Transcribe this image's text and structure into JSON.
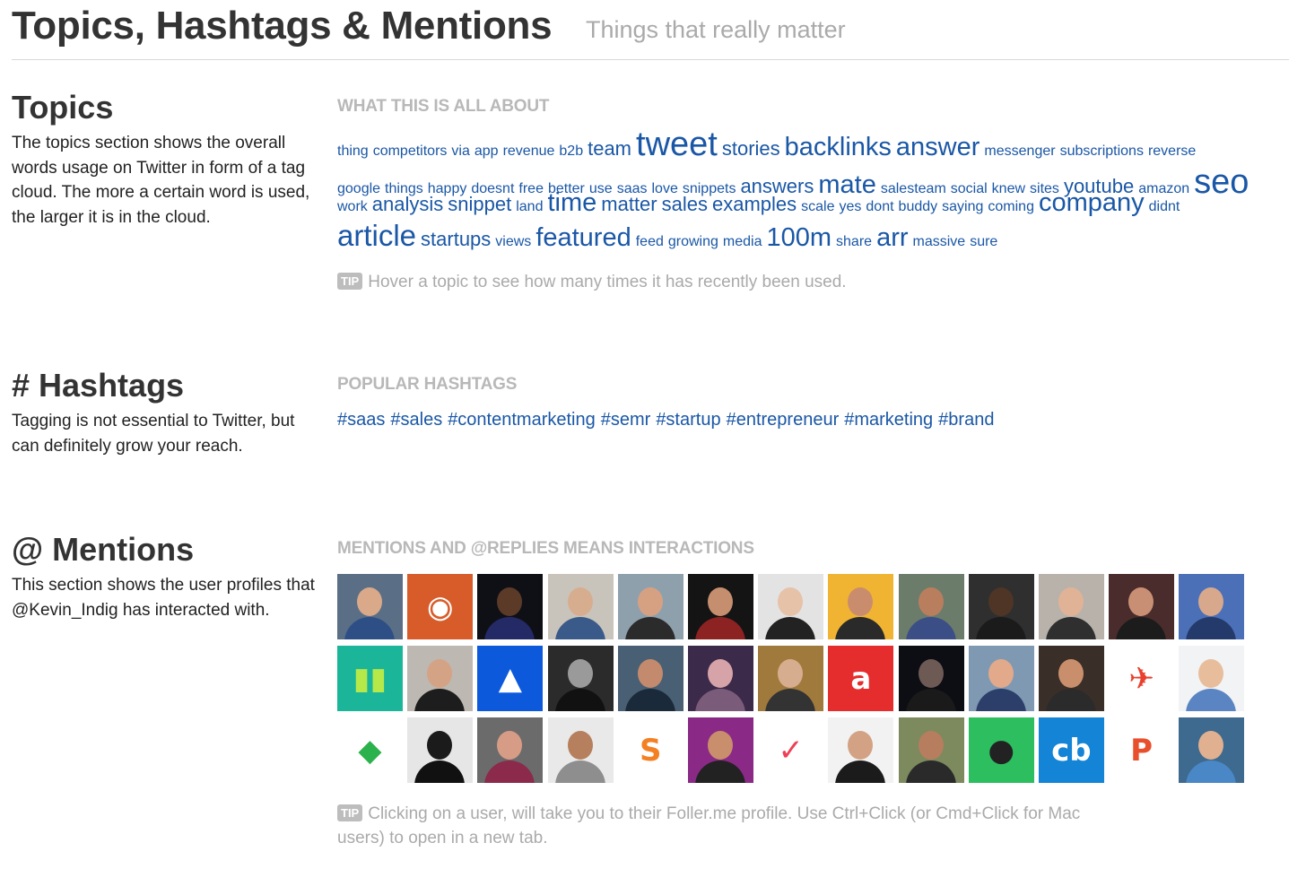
{
  "header": {
    "title": "Topics, Hashtags & Mentions",
    "subtitle": "Things that really matter"
  },
  "topics": {
    "title": "Topics",
    "description": "The topics section shows the overall words usage on Twitter in form of a tag cloud. The more a certain word is used, the larger it is in the cloud.",
    "kicker": "WHAT THIS IS ALL ABOUT",
    "tip_badge": "TIP",
    "tip": "Hover a topic to see how many times it has recently been used.",
    "cloud": [
      [
        {
          "word": "thing",
          "size": 1
        },
        {
          "word": "competitors",
          "size": 1
        },
        {
          "word": "via",
          "size": 1
        },
        {
          "word": "app",
          "size": 1
        },
        {
          "word": "revenue",
          "size": 1
        },
        {
          "word": "b2b",
          "size": 1
        },
        {
          "word": "team",
          "size": 3
        },
        {
          "word": "tweet",
          "size": 7
        },
        {
          "word": "stories",
          "size": 3
        },
        {
          "word": "backlinks",
          "size": 5
        },
        {
          "word": "answer",
          "size": 5
        },
        {
          "word": "messenger",
          "size": 1
        },
        {
          "word": "subscriptions",
          "size": 1
        },
        {
          "word": "reverse",
          "size": 1
        }
      ],
      [
        {
          "word": "google",
          "size": 1
        },
        {
          "word": "things",
          "size": 1
        },
        {
          "word": "happy",
          "size": 1
        },
        {
          "word": "doesnt",
          "size": 1
        },
        {
          "word": "free",
          "size": 1
        },
        {
          "word": "better",
          "size": 1
        },
        {
          "word": "use",
          "size": 1
        },
        {
          "word": "saas",
          "size": 1
        },
        {
          "word": "love",
          "size": 1
        },
        {
          "word": "snippets",
          "size": 1
        },
        {
          "word": "answers",
          "size": 3
        },
        {
          "word": "mate",
          "size": 5
        },
        {
          "word": "salesteam",
          "size": 1
        },
        {
          "word": "social",
          "size": 1
        },
        {
          "word": "knew",
          "size": 1
        },
        {
          "word": "sites",
          "size": 1
        },
        {
          "word": "youtube",
          "size": 3
        },
        {
          "word": "amazon",
          "size": 1
        },
        {
          "word": "seo",
          "size": 7
        }
      ],
      [
        {
          "word": "work",
          "size": 1
        },
        {
          "word": "analysis",
          "size": 3
        },
        {
          "word": "snippet",
          "size": 3
        },
        {
          "word": "land",
          "size": 1
        },
        {
          "word": "time",
          "size": 5
        },
        {
          "word": "matter",
          "size": 3
        },
        {
          "word": "sales",
          "size": 3
        },
        {
          "word": "examples",
          "size": 3
        },
        {
          "word": "scale",
          "size": 1
        },
        {
          "word": "yes",
          "size": 1
        },
        {
          "word": "dont",
          "size": 1
        },
        {
          "word": "buddy",
          "size": 1
        },
        {
          "word": "saying",
          "size": 1
        },
        {
          "word": "coming",
          "size": 1
        },
        {
          "word": "company",
          "size": 5
        },
        {
          "word": "didnt",
          "size": 1
        }
      ],
      [
        {
          "word": "article",
          "size": 6
        },
        {
          "word": "startups",
          "size": 3
        },
        {
          "word": "views",
          "size": 1
        },
        {
          "word": "featured",
          "size": 5
        },
        {
          "word": "feed",
          "size": 1
        },
        {
          "word": "growing",
          "size": 1
        },
        {
          "word": "media",
          "size": 1
        },
        {
          "word": "100m",
          "size": 5
        },
        {
          "word": "share",
          "size": 1
        },
        {
          "word": "arr",
          "size": 5
        },
        {
          "word": "massive",
          "size": 1
        },
        {
          "word": "sure",
          "size": 1
        }
      ]
    ]
  },
  "hashtags": {
    "title": "# Hashtags",
    "description": "Tagging is not essential to Twitter, but can definitely grow your reach.",
    "kicker": "POPULAR HASHTAGS",
    "items": [
      "#saas",
      "#sales",
      "#contentmarketing",
      "#semr",
      "#startup",
      "#entrepreneur",
      "#marketing",
      "#brand"
    ]
  },
  "mentions": {
    "title": "@ Mentions",
    "description": "This section shows the user profiles that @Kevin_Indig has interacted with.",
    "kicker": "MENTIONS AND @REPLIES MEANS INTERACTIONS",
    "tip_badge": "TIP",
    "tip": "Clicking on a user, will take you to their Foller.me profile. Use Ctrl+Click (or Cmd+Click for Mac users) to open in a new tab.",
    "avatars": [
      {
        "kind": "person",
        "bg": "#5a6f86",
        "skin": "#d9a98a",
        "shirt": "#2d4f86"
      },
      {
        "kind": "logo",
        "bg": "#d85b2a",
        "glyph": "◉",
        "fg": "#ffffff"
      },
      {
        "kind": "person",
        "bg": "#0f1016",
        "skin": "#5b3a28",
        "shirt": "#232a66"
      },
      {
        "kind": "person",
        "bg": "#c9c4bb",
        "skin": "#d7ad8f",
        "shirt": "#3a5a8a"
      },
      {
        "kind": "person",
        "bg": "#8fa0ad",
        "skin": "#d6a182",
        "shirt": "#2b2b2b"
      },
      {
        "kind": "person",
        "bg": "#141414",
        "skin": "#c58e6f",
        "shirt": "#8d2222"
      },
      {
        "kind": "person",
        "bg": "#e3e3e3",
        "skin": "#e6c2a8",
        "shirt": "#222222"
      },
      {
        "kind": "person",
        "bg": "#f0b432",
        "skin": "#c98d6e",
        "shirt": "#2a2a2a"
      },
      {
        "kind": "person",
        "bg": "#6c7c6a",
        "skin": "#b97e5e",
        "shirt": "#3b4f86"
      },
      {
        "kind": "person",
        "bg": "#2f2f2f",
        "skin": "#4e3526",
        "shirt": "#1b1b1b"
      },
      {
        "kind": "person",
        "bg": "#b8b2ab",
        "skin": "#e0b396",
        "shirt": "#2f2f2f"
      },
      {
        "kind": "person",
        "bg": "#4a2c2c",
        "skin": "#c98f74",
        "shirt": "#1c1c1c"
      },
      {
        "kind": "person",
        "bg": "#4c70b8",
        "skin": "#d8a88d",
        "shirt": "#233a6b"
      },
      {
        "kind": "logo",
        "bg": "#1bb59a",
        "glyph": "▮▮",
        "fg": "#b7e84a"
      },
      {
        "kind": "person",
        "bg": "#bdb8b2",
        "skin": "#d4a386",
        "shirt": "#1d1d1d"
      },
      {
        "kind": "logo",
        "bg": "#0c5adb",
        "glyph": "▲",
        "fg": "#ffffff"
      },
      {
        "kind": "person",
        "bg": "#2b2b2b",
        "skin": "#9a9a9a",
        "shirt": "#111111"
      },
      {
        "kind": "person",
        "bg": "#495f73",
        "skin": "#c48a6d",
        "shirt": "#1a2a3a"
      },
      {
        "kind": "person",
        "bg": "#3b2a4a",
        "skin": "#d6a3a8",
        "shirt": "#7a5b7a"
      },
      {
        "kind": "person",
        "bg": "#a07a3c",
        "skin": "#d7ad8f",
        "shirt": "#333333"
      },
      {
        "kind": "logo",
        "bg": "#e52d2d",
        "glyph": "a",
        "fg": "#ffffff"
      },
      {
        "kind": "person",
        "bg": "#0d0d14",
        "skin": "#6d5a55",
        "shirt": "#1a1a1a"
      },
      {
        "kind": "person",
        "bg": "#7f99b3",
        "skin": "#e2a98b",
        "shirt": "#2b3f6a"
      },
      {
        "kind": "person",
        "bg": "#3a2e28",
        "skin": "#c98f6c",
        "shirt": "#2b2b2b"
      },
      {
        "kind": "logo",
        "bg": "#ffffff",
        "glyph": "✈",
        "fg": "#e8412e"
      },
      {
        "kind": "person",
        "bg": "#f1f3f5",
        "skin": "#e8bd9c",
        "shirt": "#5b84c2"
      },
      {
        "kind": "logo",
        "bg": "#ffffff",
        "glyph": "◆",
        "fg": "#2bb24c"
      },
      {
        "kind": "person",
        "bg": "#e6e6e6",
        "skin": "#1b1b1b",
        "shirt": "#111111"
      },
      {
        "kind": "person",
        "bg": "#6b6b6b",
        "skin": "#d69c86",
        "shirt": "#8b2a4a"
      },
      {
        "kind": "person",
        "bg": "#e9e9e9",
        "skin": "#b67f5e",
        "shirt": "#8e8e8e"
      },
      {
        "kind": "logo",
        "bg": "#ffffff",
        "glyph": "S",
        "fg": "#f48024"
      },
      {
        "kind": "person",
        "bg": "#8a2a86",
        "skin": "#c98f6c",
        "shirt": "#222222"
      },
      {
        "kind": "logo",
        "bg": "#ffffff",
        "glyph": "✓",
        "fg": "#ee4056"
      },
      {
        "kind": "person",
        "bg": "#f2f2f2",
        "skin": "#d3a284",
        "shirt": "#1b1b1b"
      },
      {
        "kind": "person",
        "bg": "#7c8a5e",
        "skin": "#b67e5e",
        "shirt": "#2a2a2a"
      },
      {
        "kind": "logo",
        "bg": "#2dbe60",
        "glyph": "●",
        "fg": "#222222"
      },
      {
        "kind": "logo",
        "bg": "#1484d6",
        "glyph": "cb",
        "fg": "#ffffff"
      },
      {
        "kind": "logo",
        "bg": "#ffffff",
        "glyph": "P",
        "fg": "#e8502d"
      },
      {
        "kind": "person",
        "bg": "#3d6a8e",
        "skin": "#e0b090",
        "shirt": "#4a87c7"
      }
    ]
  }
}
